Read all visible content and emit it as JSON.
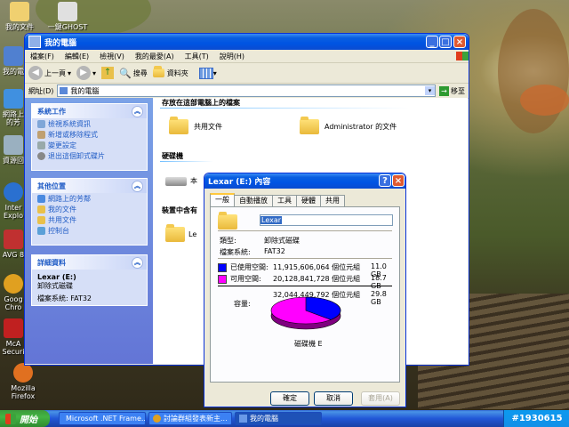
{
  "desktop": {
    "icons": [
      {
        "label": "我的文件",
        "color": "#f0d070"
      },
      {
        "label": "一鍵GHOST",
        "color": "#e0e0e0"
      },
      {
        "label": "我的電",
        "color": "#5080d0"
      },
      {
        "label": "網路上的芳",
        "color": "#4090e0"
      },
      {
        "label": "資源回",
        "color": "#9ab0c0"
      },
      {
        "label": "Inter Explo",
        "color": "#2a70d0"
      },
      {
        "label": "AVG 8",
        "color": "#c03030"
      },
      {
        "label": "Goog Chro",
        "color": "#e0a020"
      },
      {
        "label": "McA Securi",
        "color": "#c02020"
      },
      {
        "label": "Mozilla Firefox",
        "color": "#e07020"
      }
    ]
  },
  "explorer": {
    "title": "我的電腦",
    "menu": [
      "檔案(F)",
      "編輯(E)",
      "檢視(V)",
      "我的最愛(A)",
      "工具(T)",
      "說明(H)"
    ],
    "toolbar": {
      "back": "上一頁",
      "search": "搜尋",
      "folders": "資料夾"
    },
    "address": {
      "label": "網址(D)",
      "value": "我的電腦",
      "go": "移至"
    },
    "tasks": {
      "system_title": "系統工作",
      "system_items": [
        "檢視系統資訊",
        "新增或移除程式",
        "變更設定",
        "退出這個卸式碟片"
      ],
      "other_title": "其他位置",
      "other_items": [
        "網路上的芳鄰",
        "我的文件",
        "共用文件",
        "控制台"
      ],
      "details_title": "詳細資料",
      "details_name": "Lexar (E:)",
      "details_type": "卸除式磁碟",
      "details_fs": "檔案系統: FAT32"
    },
    "sections": {
      "stored": "存放在這部電腦上的檔案",
      "shared_docs": "共用文件",
      "admin_docs": "Administrator 的文件",
      "hdd": "硬碟機",
      "hdd_item": "本",
      "removable": "裝置中含有",
      "removable_item": "Le"
    }
  },
  "dialog": {
    "title": "Lexar (E:) 內容",
    "tabs": [
      "一般",
      "自動播放",
      "工具",
      "硬體",
      "共用"
    ],
    "name_value": "Lexar",
    "type_label": "類型:",
    "type_value": "卸除式磁碟",
    "fs_label": "檔案系統:",
    "fs_value": "FAT32",
    "used_label": "已使用空間:",
    "used_bytes": "11,915,606,064 個位元組",
    "used_gb": "11.0 GB",
    "free_label": "可用空間:",
    "free_bytes": "20,128,841,728 個位元組",
    "free_gb": "18.7 GB",
    "capacity_label": "容量:",
    "capacity_bytes": "32,044,449,792 個位元組",
    "capacity_gb": "29.8 GB",
    "drive_label": "磁碟機 E",
    "ok": "確定",
    "cancel": "取消",
    "apply": "套用(A)",
    "colors": {
      "used": "#0000ff",
      "free": "#ff00ff"
    },
    "used_fraction": 0.372
  },
  "taskbar": {
    "start": "開始",
    "tasks": [
      "Microsoft .NET Frame...",
      "討論群組發表新主...",
      "我的電腦"
    ],
    "tray_text": "#1930615"
  }
}
